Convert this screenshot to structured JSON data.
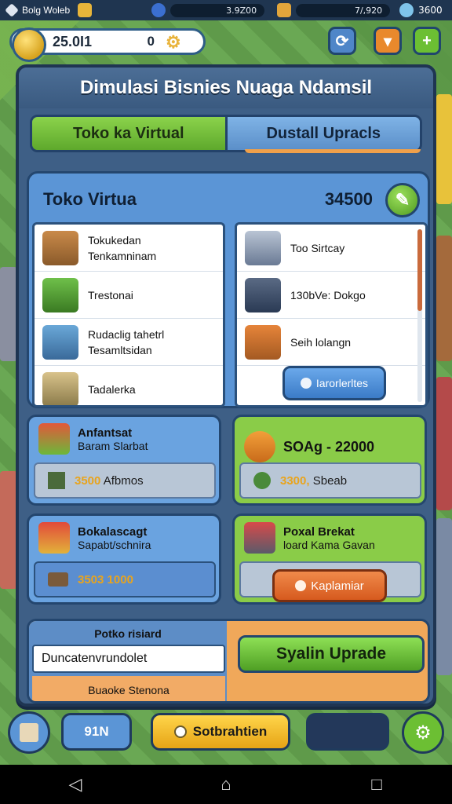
{
  "status_bar": {
    "player_name": "Bolg Woleb",
    "resource_1": "3.9Z00",
    "resource_2": "7/,920",
    "resource_3": "3600"
  },
  "header": {
    "money": "25.0I1",
    "money_secondary": "0"
  },
  "panel": {
    "title": "Dimulasi Bisnies Nuaga Ndamsil"
  },
  "tabs": [
    {
      "label": "Toko ka Virtual",
      "active": true
    },
    {
      "label": "Dustall Upracls",
      "active": false
    }
  ],
  "store": {
    "title": "Toko Virtua",
    "amount": "34500",
    "left_items": [
      {
        "label": "Tokukedan\nTenkamninam",
        "icon": "crate-icon"
      },
      {
        "label": "Trestonai",
        "icon": "plant-box-icon"
      },
      {
        "label": "Rudaclig tahetrl\nTesamltsidan",
        "icon": "shop-building-icon"
      },
      {
        "label": "Tadalerka",
        "icon": "book-stack-icon"
      }
    ],
    "right_items": [
      {
        "label": "Too Sirtcay",
        "icon": "tools-icon"
      },
      {
        "label": "130bVe: Dokgo",
        "icon": "tower-icon"
      },
      {
        "label": "Seih lolangn",
        "icon": "block-icon"
      }
    ],
    "right_button": "Iarorlerltes"
  },
  "stats": [
    {
      "title": "Anfantsat",
      "subtitle": "Baram Slarbat",
      "bottom_gold": "3500",
      "bottom_text": "Afbmos",
      "icon": "vegetables-icon",
      "bottom_icon": "cube-icon"
    },
    {
      "title": "",
      "subtitle": "",
      "big_text": "SOAg - 22000",
      "bottom_gold": "3300,",
      "bottom_text": "Sbeab",
      "icon": "basket-icon",
      "bottom_icon": "leaf-icon"
    },
    {
      "title": "Bokalascagt",
      "subtitle": "Sapabt/schnira",
      "bottom_gold": "3503",
      "bottom_text": "1000",
      "icon": "market-stall-icon",
      "bottom_icon": "cart-icon"
    },
    {
      "title": "Poxal Brekat",
      "subtitle": "loard Kama Gavan",
      "button": "Kaplamiar",
      "icon": "vendor-cart-icon"
    }
  ],
  "bottom_card": {
    "label": "Potko risiard",
    "input_value": "Duncatenvrundolet",
    "sub_label": "Buaoke Stenona",
    "button": "Syalin Uprade"
  },
  "toolbar": {
    "level": "91N",
    "main_button": "Sotbrahtien"
  },
  "colors": {
    "accent_green": "#6ab832",
    "accent_blue": "#5b95d6",
    "accent_orange": "#e26a2c",
    "panel_dark": "#3e5f86"
  }
}
